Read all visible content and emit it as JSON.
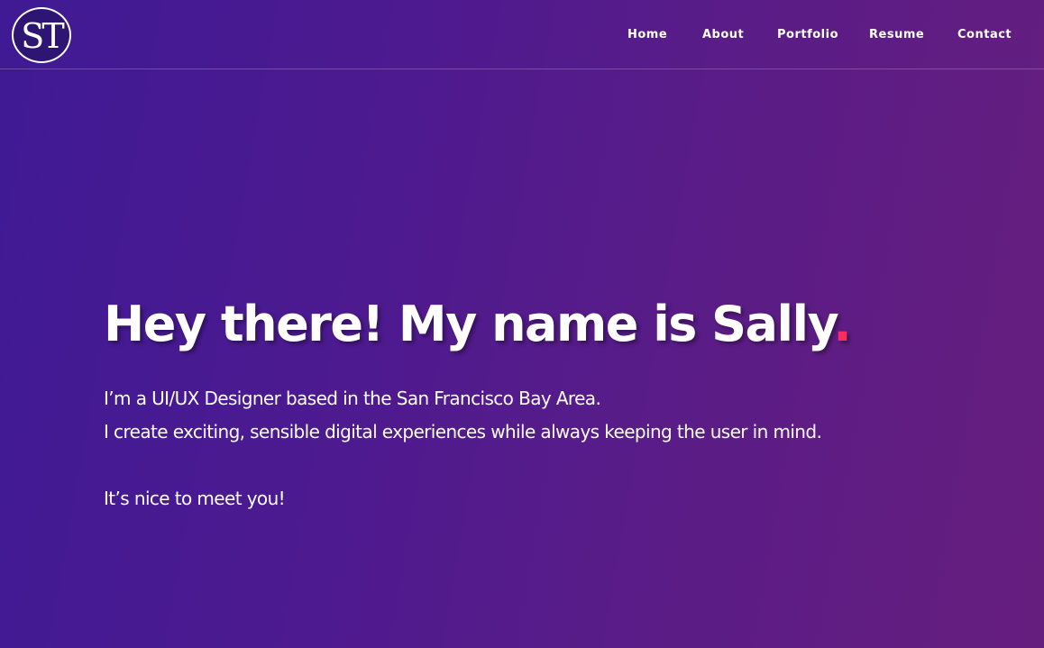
{
  "logo": {
    "text": "ST"
  },
  "nav": {
    "items": [
      {
        "label": "Home"
      },
      {
        "label": "About"
      },
      {
        "label": "Portfolio"
      },
      {
        "label": "Resume"
      },
      {
        "label": "Contact"
      }
    ]
  },
  "hero": {
    "title": "Hey there! My name is Sally",
    "title_dot": ".",
    "line_1": "I’m a UI/UX Designer based in the San Francisco Bay Area.",
    "line_2": "I create exciting, sensible digital experiences while always keeping the user in mind.",
    "greeting": "It’s nice to meet you!"
  },
  "colors": {
    "accent": "#ff2a5f",
    "background_start": "#3f1a94",
    "background_end": "#661e7e"
  }
}
